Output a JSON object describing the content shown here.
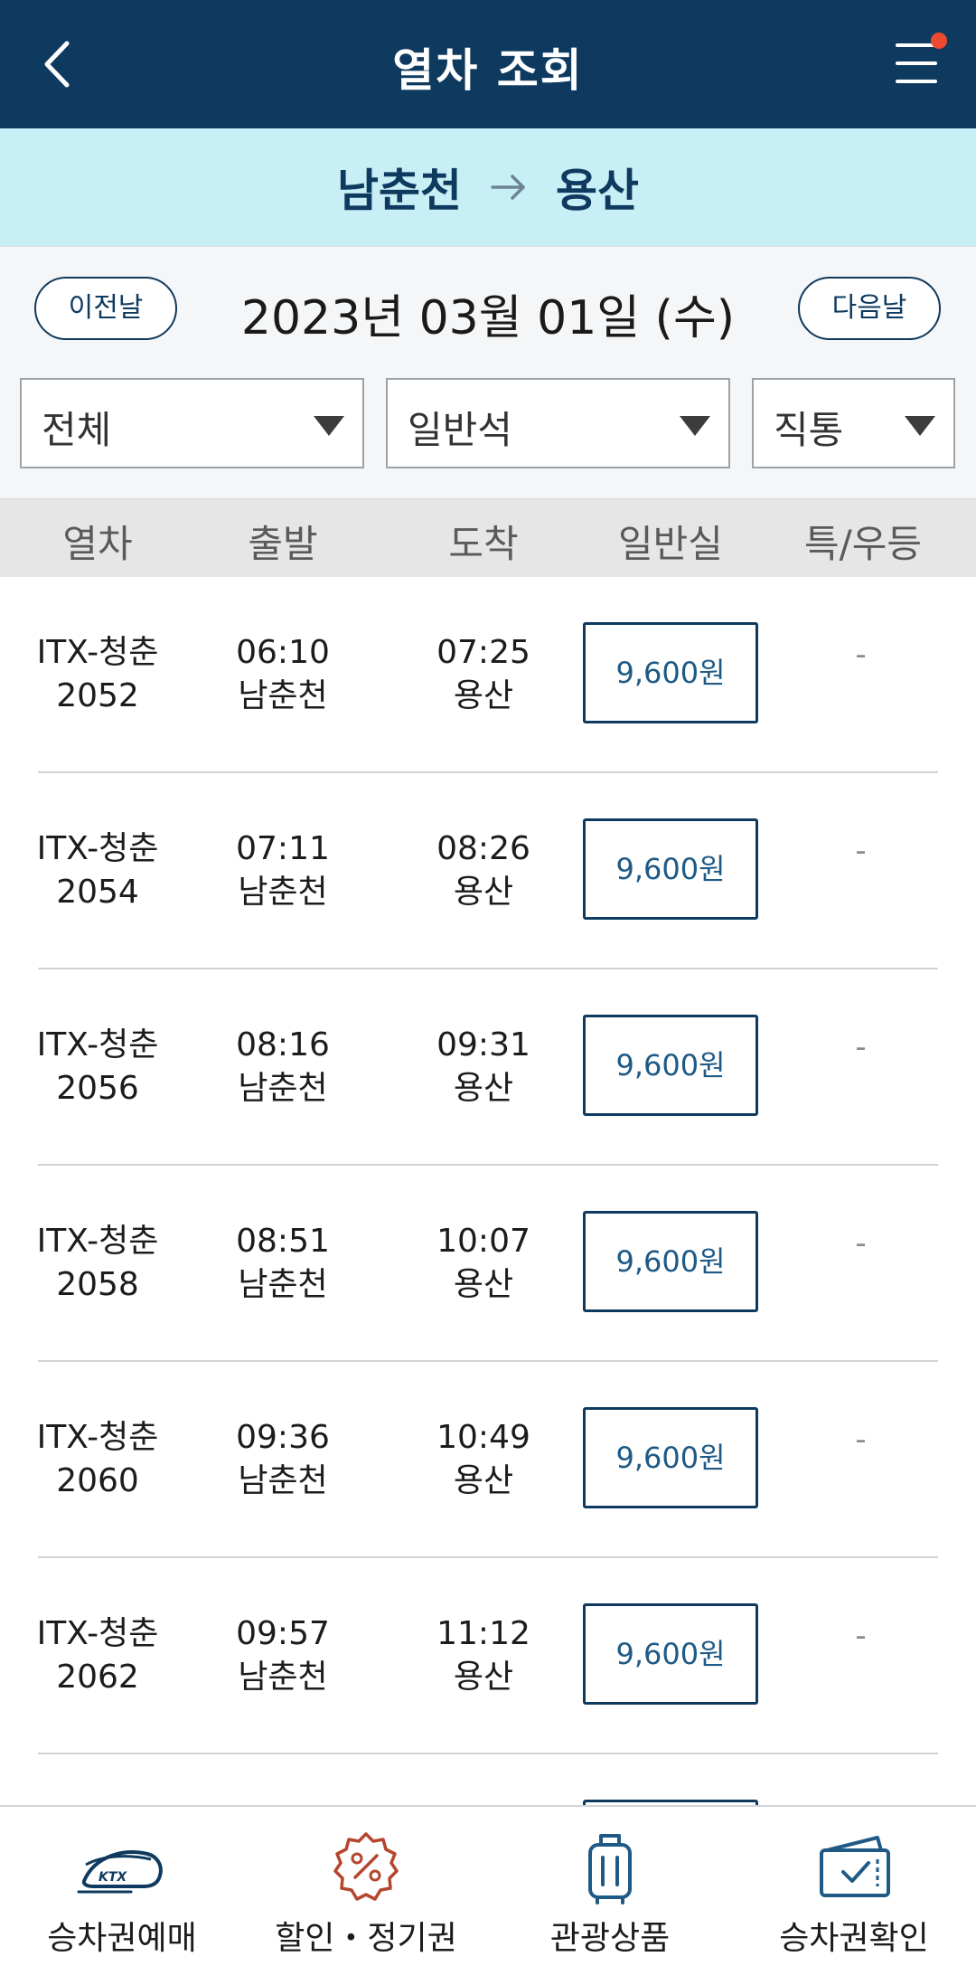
{
  "header": {
    "title": "열차 조회"
  },
  "route": {
    "from": "남춘천",
    "to": "용산"
  },
  "date_bar": {
    "prev_label": "이전날",
    "date": "2023년 03월 01일 (수)",
    "next_label": "다음날"
  },
  "filters": {
    "train_type": "전체",
    "seat_class": "일반석",
    "direct": "직통"
  },
  "table": {
    "columns": [
      "열차",
      "출발",
      "도착",
      "일반실",
      "특/우등"
    ],
    "rows": [
      {
        "train": "ITX-청춘",
        "number": "2052",
        "dep_time": "06:10",
        "dep_station": "남춘천",
        "arr_time": "07:25",
        "arr_station": "용산",
        "price": "9,600원",
        "special": "-"
      },
      {
        "train": "ITX-청춘",
        "number": "2054",
        "dep_time": "07:11",
        "dep_station": "남춘천",
        "arr_time": "08:26",
        "arr_station": "용산",
        "price": "9,600원",
        "special": "-"
      },
      {
        "train": "ITX-청춘",
        "number": "2056",
        "dep_time": "08:16",
        "dep_station": "남춘천",
        "arr_time": "09:31",
        "arr_station": "용산",
        "price": "9,600원",
        "special": "-"
      },
      {
        "train": "ITX-청춘",
        "number": "2058",
        "dep_time": "08:51",
        "dep_station": "남춘천",
        "arr_time": "10:07",
        "arr_station": "용산",
        "price": "9,600원",
        "special": "-"
      },
      {
        "train": "ITX-청춘",
        "number": "2060",
        "dep_time": "09:36",
        "dep_station": "남춘천",
        "arr_time": "10:49",
        "arr_station": "용산",
        "price": "9,600원",
        "special": "-"
      },
      {
        "train": "ITX-청춘",
        "number": "2062",
        "dep_time": "09:57",
        "dep_station": "남춘천",
        "arr_time": "11:12",
        "arr_station": "용산",
        "price": "9,600원",
        "special": "-"
      }
    ]
  },
  "bottom_nav": [
    {
      "label": "승차권예매",
      "icon": "ktx-train-icon"
    },
    {
      "label": "할인・정기권",
      "icon": "discount-badge-icon"
    },
    {
      "label": "관광상품",
      "icon": "suitcase-icon"
    },
    {
      "label": "승차권확인",
      "icon": "ticket-check-icon"
    }
  ],
  "colors": {
    "header_bg": "#0f3a5f",
    "route_bg": "#c8eff5",
    "accent_text": "#1f5a86",
    "notification_dot": "#ee4a2f"
  }
}
